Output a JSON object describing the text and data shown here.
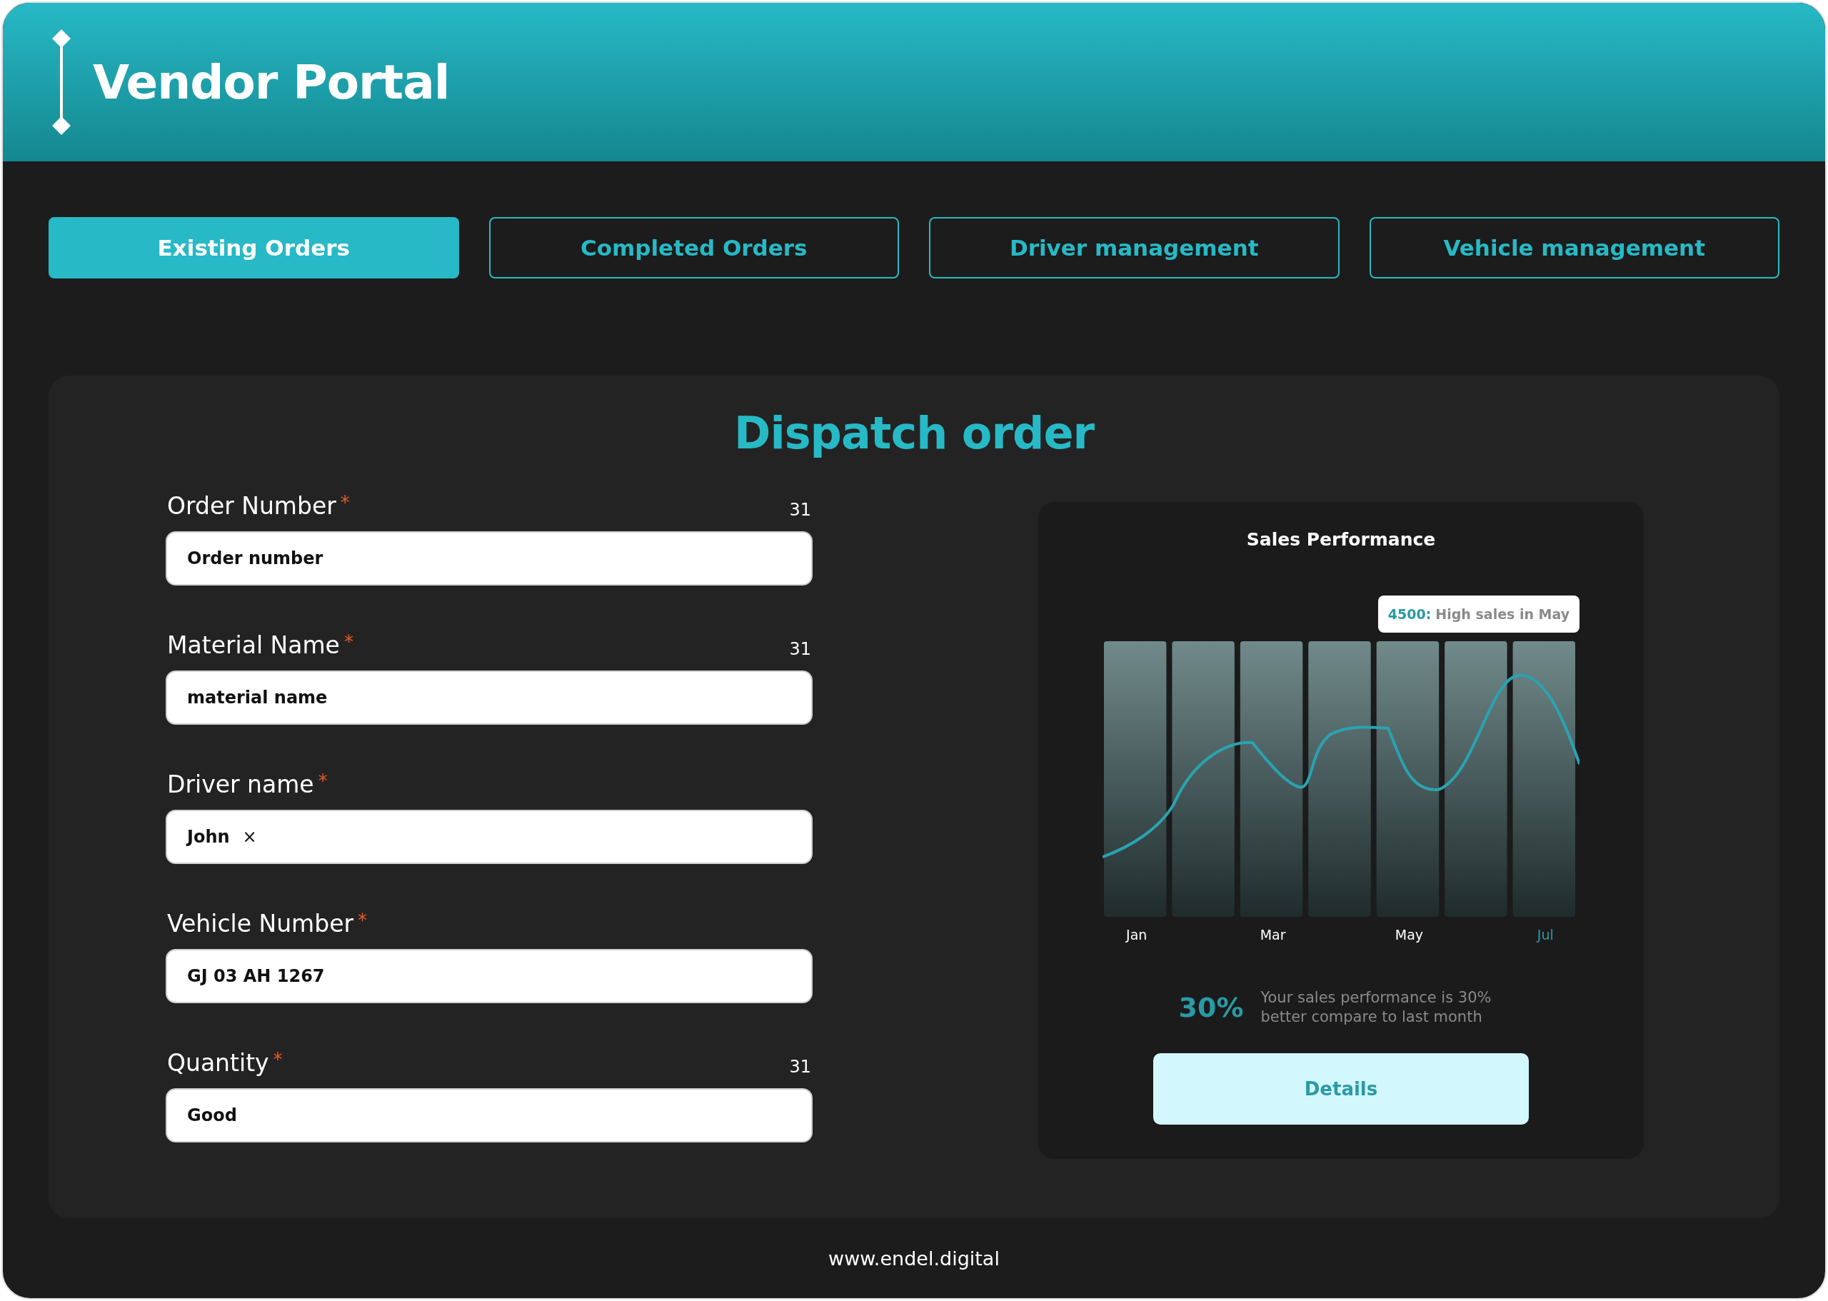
{
  "header": {
    "title": "Vendor Portal"
  },
  "tabs": [
    {
      "label": "Existing Orders",
      "selected": true
    },
    {
      "label": "Completed Orders",
      "selected": false
    },
    {
      "label": "Driver management",
      "selected": false
    },
    {
      "label": "Vehicle management",
      "selected": false
    }
  ],
  "form": {
    "title": "Dispatch order",
    "fields": [
      {
        "kind": "text",
        "label": "Order Number",
        "required_mark": "*",
        "counter": "31",
        "value": "Order number"
      },
      {
        "kind": "text",
        "label": "Material Name",
        "required_mark": "*",
        "counter": "31",
        "value": "material name"
      },
      {
        "kind": "chip",
        "label": "Driver name",
        "required_mark": "*",
        "value": "John",
        "remove": "×"
      },
      {
        "kind": "text",
        "label": "Vehicle Number",
        "required_mark": "*",
        "value": "GJ 03 AH 1267"
      },
      {
        "kind": "text",
        "label": "Quantity",
        "required_mark": "*",
        "counter": "31",
        "value": "Good"
      }
    ]
  },
  "sales_card": {
    "title": "Sales Performance",
    "tooltip": {
      "value": "4500:",
      "text": "High sales in May"
    },
    "months": [
      {
        "label": "Jan",
        "selected": false
      },
      {
        "label": "Mar",
        "selected": false
      },
      {
        "label": "May",
        "selected": false
      },
      {
        "label": "Jul",
        "selected": true
      }
    ],
    "percent": "30%",
    "summary": "Your sales performance is 30% better compare to last month",
    "button": "Details"
  },
  "footer": "www.endel.digital"
}
